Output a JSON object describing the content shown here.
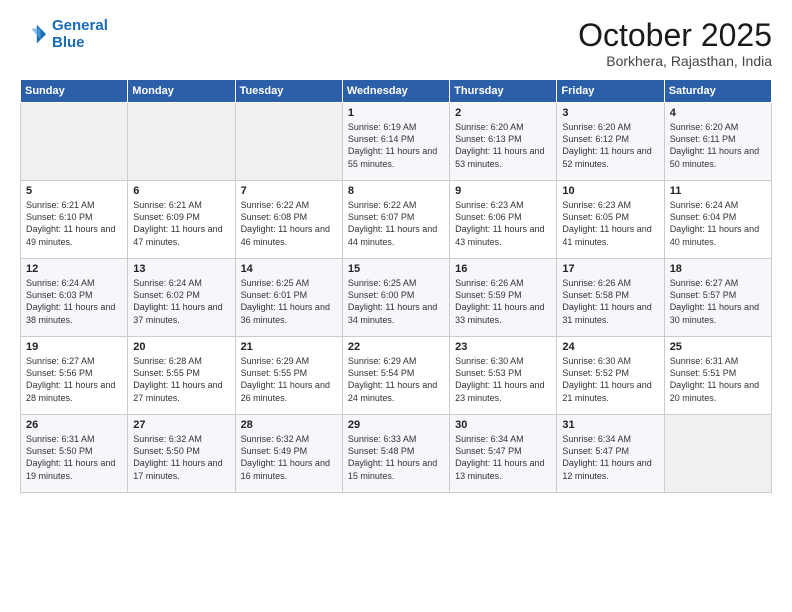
{
  "logo": {
    "line1": "General",
    "line2": "Blue"
  },
  "header": {
    "month": "October 2025",
    "location": "Borkhera, Rajasthan, India"
  },
  "days_of_week": [
    "Sunday",
    "Monday",
    "Tuesday",
    "Wednesday",
    "Thursday",
    "Friday",
    "Saturday"
  ],
  "weeks": [
    [
      {
        "day": "",
        "sunrise": "",
        "sunset": "",
        "daylight": ""
      },
      {
        "day": "",
        "sunrise": "",
        "sunset": "",
        "daylight": ""
      },
      {
        "day": "",
        "sunrise": "",
        "sunset": "",
        "daylight": ""
      },
      {
        "day": "1",
        "sunrise": "Sunrise: 6:19 AM",
        "sunset": "Sunset: 6:14 PM",
        "daylight": "Daylight: 11 hours and 55 minutes."
      },
      {
        "day": "2",
        "sunrise": "Sunrise: 6:20 AM",
        "sunset": "Sunset: 6:13 PM",
        "daylight": "Daylight: 11 hours and 53 minutes."
      },
      {
        "day": "3",
        "sunrise": "Sunrise: 6:20 AM",
        "sunset": "Sunset: 6:12 PM",
        "daylight": "Daylight: 11 hours and 52 minutes."
      },
      {
        "day": "4",
        "sunrise": "Sunrise: 6:20 AM",
        "sunset": "Sunset: 6:11 PM",
        "daylight": "Daylight: 11 hours and 50 minutes."
      }
    ],
    [
      {
        "day": "5",
        "sunrise": "Sunrise: 6:21 AM",
        "sunset": "Sunset: 6:10 PM",
        "daylight": "Daylight: 11 hours and 49 minutes."
      },
      {
        "day": "6",
        "sunrise": "Sunrise: 6:21 AM",
        "sunset": "Sunset: 6:09 PM",
        "daylight": "Daylight: 11 hours and 47 minutes."
      },
      {
        "day": "7",
        "sunrise": "Sunrise: 6:22 AM",
        "sunset": "Sunset: 6:08 PM",
        "daylight": "Daylight: 11 hours and 46 minutes."
      },
      {
        "day": "8",
        "sunrise": "Sunrise: 6:22 AM",
        "sunset": "Sunset: 6:07 PM",
        "daylight": "Daylight: 11 hours and 44 minutes."
      },
      {
        "day": "9",
        "sunrise": "Sunrise: 6:23 AM",
        "sunset": "Sunset: 6:06 PM",
        "daylight": "Daylight: 11 hours and 43 minutes."
      },
      {
        "day": "10",
        "sunrise": "Sunrise: 6:23 AM",
        "sunset": "Sunset: 6:05 PM",
        "daylight": "Daylight: 11 hours and 41 minutes."
      },
      {
        "day": "11",
        "sunrise": "Sunrise: 6:24 AM",
        "sunset": "Sunset: 6:04 PM",
        "daylight": "Daylight: 11 hours and 40 minutes."
      }
    ],
    [
      {
        "day": "12",
        "sunrise": "Sunrise: 6:24 AM",
        "sunset": "Sunset: 6:03 PM",
        "daylight": "Daylight: 11 hours and 38 minutes."
      },
      {
        "day": "13",
        "sunrise": "Sunrise: 6:24 AM",
        "sunset": "Sunset: 6:02 PM",
        "daylight": "Daylight: 11 hours and 37 minutes."
      },
      {
        "day": "14",
        "sunrise": "Sunrise: 6:25 AM",
        "sunset": "Sunset: 6:01 PM",
        "daylight": "Daylight: 11 hours and 36 minutes."
      },
      {
        "day": "15",
        "sunrise": "Sunrise: 6:25 AM",
        "sunset": "Sunset: 6:00 PM",
        "daylight": "Daylight: 11 hours and 34 minutes."
      },
      {
        "day": "16",
        "sunrise": "Sunrise: 6:26 AM",
        "sunset": "Sunset: 5:59 PM",
        "daylight": "Daylight: 11 hours and 33 minutes."
      },
      {
        "day": "17",
        "sunrise": "Sunrise: 6:26 AM",
        "sunset": "Sunset: 5:58 PM",
        "daylight": "Daylight: 11 hours and 31 minutes."
      },
      {
        "day": "18",
        "sunrise": "Sunrise: 6:27 AM",
        "sunset": "Sunset: 5:57 PM",
        "daylight": "Daylight: 11 hours and 30 minutes."
      }
    ],
    [
      {
        "day": "19",
        "sunrise": "Sunrise: 6:27 AM",
        "sunset": "Sunset: 5:56 PM",
        "daylight": "Daylight: 11 hours and 28 minutes."
      },
      {
        "day": "20",
        "sunrise": "Sunrise: 6:28 AM",
        "sunset": "Sunset: 5:55 PM",
        "daylight": "Daylight: 11 hours and 27 minutes."
      },
      {
        "day": "21",
        "sunrise": "Sunrise: 6:29 AM",
        "sunset": "Sunset: 5:55 PM",
        "daylight": "Daylight: 11 hours and 26 minutes."
      },
      {
        "day": "22",
        "sunrise": "Sunrise: 6:29 AM",
        "sunset": "Sunset: 5:54 PM",
        "daylight": "Daylight: 11 hours and 24 minutes."
      },
      {
        "day": "23",
        "sunrise": "Sunrise: 6:30 AM",
        "sunset": "Sunset: 5:53 PM",
        "daylight": "Daylight: 11 hours and 23 minutes."
      },
      {
        "day": "24",
        "sunrise": "Sunrise: 6:30 AM",
        "sunset": "Sunset: 5:52 PM",
        "daylight": "Daylight: 11 hours and 21 minutes."
      },
      {
        "day": "25",
        "sunrise": "Sunrise: 6:31 AM",
        "sunset": "Sunset: 5:51 PM",
        "daylight": "Daylight: 11 hours and 20 minutes."
      }
    ],
    [
      {
        "day": "26",
        "sunrise": "Sunrise: 6:31 AM",
        "sunset": "Sunset: 5:50 PM",
        "daylight": "Daylight: 11 hours and 19 minutes."
      },
      {
        "day": "27",
        "sunrise": "Sunrise: 6:32 AM",
        "sunset": "Sunset: 5:50 PM",
        "daylight": "Daylight: 11 hours and 17 minutes."
      },
      {
        "day": "28",
        "sunrise": "Sunrise: 6:32 AM",
        "sunset": "Sunset: 5:49 PM",
        "daylight": "Daylight: 11 hours and 16 minutes."
      },
      {
        "day": "29",
        "sunrise": "Sunrise: 6:33 AM",
        "sunset": "Sunset: 5:48 PM",
        "daylight": "Daylight: 11 hours and 15 minutes."
      },
      {
        "day": "30",
        "sunrise": "Sunrise: 6:34 AM",
        "sunset": "Sunset: 5:47 PM",
        "daylight": "Daylight: 11 hours and 13 minutes."
      },
      {
        "day": "31",
        "sunrise": "Sunrise: 6:34 AM",
        "sunset": "Sunset: 5:47 PM",
        "daylight": "Daylight: 11 hours and 12 minutes."
      },
      {
        "day": "",
        "sunrise": "",
        "sunset": "",
        "daylight": ""
      }
    ]
  ]
}
